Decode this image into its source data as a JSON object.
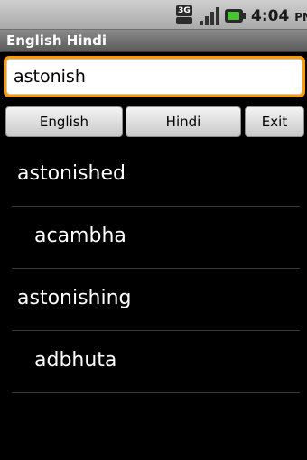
{
  "status_bar": {
    "network": "3G",
    "time": "4:04",
    "ampm": "PM",
    "icons": [
      "3g-data-icon",
      "signal-strength-icon",
      "battery-icon"
    ]
  },
  "app": {
    "title": "English Hindi"
  },
  "search": {
    "value": "astonish"
  },
  "buttons": {
    "english": "English",
    "hindi": "Hindi",
    "exit": "Exit"
  },
  "results": [
    {
      "type": "word",
      "text": "astonished"
    },
    {
      "type": "meaning",
      "text": "acambha"
    },
    {
      "type": "word",
      "text": "astonishing"
    },
    {
      "type": "meaning",
      "text": "adbhuta"
    }
  ],
  "colors": {
    "focus_accent": "#ff9a00",
    "battery_level": "#4ac433",
    "background": "#000000"
  }
}
